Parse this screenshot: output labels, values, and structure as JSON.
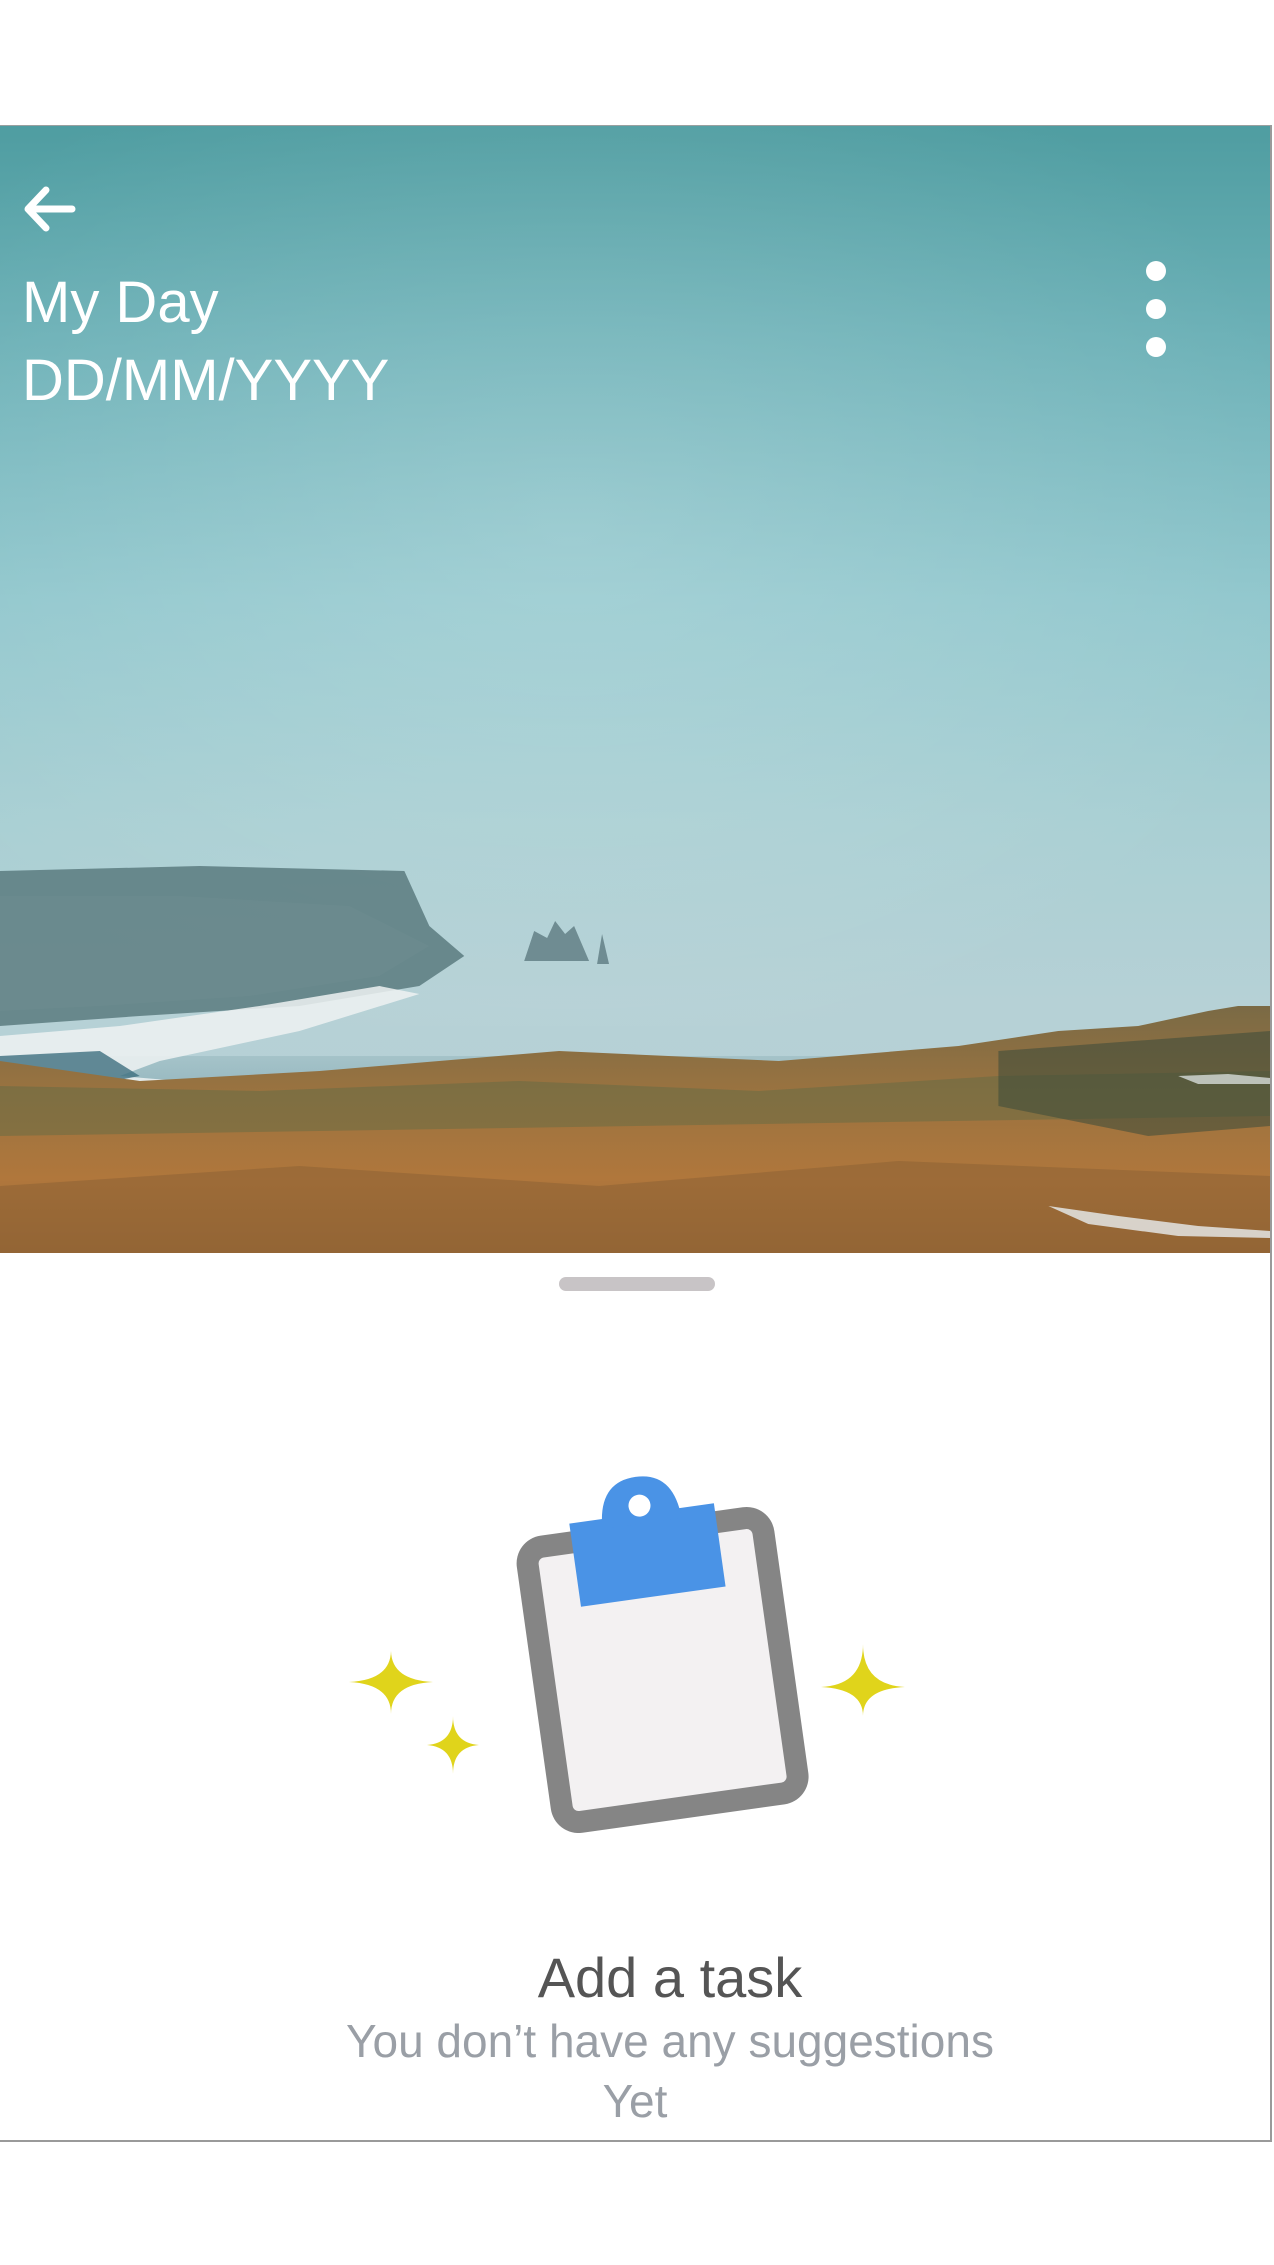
{
  "header": {
    "title": "My Day",
    "date": "DD/MM/YYYY"
  },
  "icons": {
    "back": "arrow-left-icon",
    "more": "more-vertical-icon",
    "empty_state": "clipboard-icon",
    "sparkle": "sparkle-icon"
  },
  "empty_state": {
    "title": "Add a task",
    "subtitle_line1": "You don’t have any suggestions",
    "subtitle_line2": "Yet"
  },
  "colors": {
    "sparkle": "#e0d41b",
    "clip": "#4a93e6",
    "board": "#858585",
    "paper": "#f3f1f2",
    "title_text": "#555555",
    "subtitle_text": "#9a9fa6"
  }
}
